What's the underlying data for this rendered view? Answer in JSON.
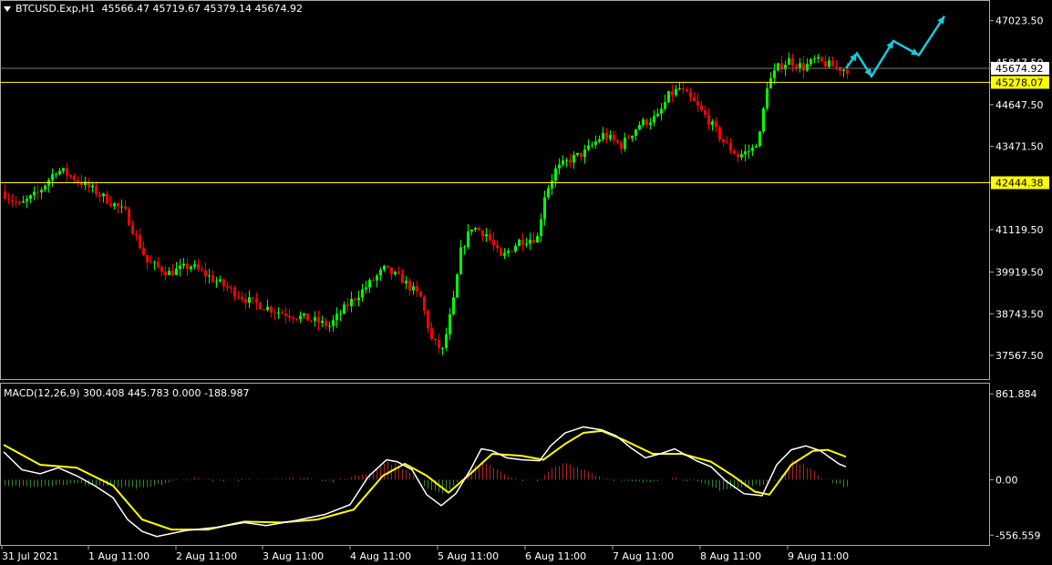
{
  "header": {
    "symbol": "BTCUSD.Exp,H1",
    "ohlc": "45566.47 45719.67 45379.14 45674.92"
  },
  "macd_header": {
    "text": "MACD(12,26,9) 300.408 445.783 0.000 -188.987"
  },
  "colors": {
    "background": "#000000",
    "bull": "#00ff00",
    "bear": "#ff0000",
    "level_line": "#ffff00",
    "forecast": "#1ec8dc",
    "macd_main": "#ffffff",
    "macd_signal": "#ffff00",
    "hist_pos": "#b22222",
    "hist_neg": "#2e8b2e"
  },
  "chart_data": [
    {
      "type": "candlestick",
      "timeframe": "H1",
      "ylim": [
        37000,
        47400
      ],
      "y_ticks": [
        "47023.50",
        "45847.50",
        "44647.50",
        "43471.50",
        "41119.50",
        "39919.50",
        "38743.50",
        "37567.50"
      ],
      "x_ticks": [
        "31 Jul 2021",
        "1 Aug 11:00",
        "2 Aug 11:00",
        "3 Aug 11:00",
        "4 Aug 11:00",
        "5 Aug 11:00",
        "6 Aug 11:00",
        "7 Aug 11:00",
        "8 Aug 11:00",
        "9 Aug 11:00"
      ],
      "price_path": [
        [
          0,
          42200
        ],
        [
          5,
          41800
        ],
        [
          10,
          42150
        ],
        [
          15,
          42800
        ],
        [
          17,
          42750
        ],
        [
          22,
          42450
        ],
        [
          30,
          41900
        ],
        [
          34,
          41600
        ],
        [
          40,
          40200
        ],
        [
          46,
          39900
        ],
        [
          52,
          40100
        ],
        [
          60,
          39600
        ],
        [
          68,
          39100
        ],
        [
          76,
          38800
        ],
        [
          84,
          38600
        ],
        [
          90,
          38400
        ],
        [
          95,
          39000
        ],
        [
          101,
          39600
        ],
        [
          105,
          40000
        ],
        [
          110,
          39700
        ],
        [
          115,
          39200
        ],
        [
          118,
          38000
        ],
        [
          121,
          37700
        ],
        [
          124,
          39100
        ],
        [
          126,
          40500
        ],
        [
          129,
          41200
        ],
        [
          133,
          41000
        ],
        [
          137,
          40300
        ],
        [
          142,
          40800
        ],
        [
          147,
          40900
        ],
        [
          149,
          42100
        ],
        [
          152,
          42800
        ],
        [
          156,
          43100
        ],
        [
          160,
          43300
        ],
        [
          165,
          43800
        ],
        [
          170,
          43500
        ],
        [
          175,
          44100
        ],
        [
          180,
          44300
        ],
        [
          183,
          44900
        ],
        [
          186,
          45100
        ],
        [
          190,
          44700
        ],
        [
          194,
          44200
        ],
        [
          198,
          43600
        ],
        [
          202,
          43200
        ],
        [
          206,
          43400
        ],
        [
          208,
          43800
        ],
        [
          210,
          45200
        ],
        [
          213,
          45700
        ],
        [
          216,
          45900
        ],
        [
          220,
          45700
        ],
        [
          223,
          45900
        ],
        [
          226,
          45800
        ],
        [
          229,
          45700
        ],
        [
          231,
          45650
        ]
      ],
      "current_price": "45674.92",
      "levels": [
        "45278.07",
        "42444.38"
      ],
      "forecast_path": [
        [
          231,
          45674
        ],
        [
          234,
          46100
        ],
        [
          238,
          45450
        ],
        [
          244,
          46450
        ],
        [
          251,
          46050
        ],
        [
          258,
          47150
        ]
      ]
    },
    {
      "type": "macd",
      "title": "MACD(12,26,9)",
      "ylim": [
        -600,
        900
      ],
      "y_ticks": [
        "861.884",
        "0.00",
        "-556.559"
      ],
      "macd_path": [
        [
          0,
          280
        ],
        [
          5,
          100
        ],
        [
          10,
          60
        ],
        [
          15,
          120
        ],
        [
          20,
          40
        ],
        [
          25,
          -60
        ],
        [
          30,
          -180
        ],
        [
          34,
          -400
        ],
        [
          38,
          -520
        ],
        [
          42,
          -570
        ],
        [
          50,
          -510
        ],
        [
          58,
          -480
        ],
        [
          66,
          -430
        ],
        [
          72,
          -460
        ],
        [
          80,
          -410
        ],
        [
          88,
          -350
        ],
        [
          95,
          -250
        ],
        [
          100,
          30
        ],
        [
          105,
          200
        ],
        [
          108,
          180
        ],
        [
          112,
          100
        ],
        [
          116,
          -150
        ],
        [
          120,
          -260
        ],
        [
          124,
          -140
        ],
        [
          128,
          100
        ],
        [
          131,
          310
        ],
        [
          134,
          290
        ],
        [
          138,
          220
        ],
        [
          142,
          200
        ],
        [
          147,
          190
        ],
        [
          150,
          340
        ],
        [
          154,
          470
        ],
        [
          159,
          530
        ],
        [
          164,
          500
        ],
        [
          168,
          440
        ],
        [
          172,
          320
        ],
        [
          176,
          220
        ],
        [
          180,
          260
        ],
        [
          184,
          310
        ],
        [
          190,
          190
        ],
        [
          194,
          130
        ],
        [
          198,
          -10
        ],
        [
          203,
          -140
        ],
        [
          208,
          -160
        ],
        [
          212,
          150
        ],
        [
          216,
          300
        ],
        [
          220,
          340
        ],
        [
          224,
          290
        ],
        [
          229,
          160
        ],
        [
          231,
          130
        ]
      ],
      "signal_path": [
        [
          0,
          350
        ],
        [
          10,
          150
        ],
        [
          20,
          120
        ],
        [
          30,
          -60
        ],
        [
          38,
          -400
        ],
        [
          46,
          -500
        ],
        [
          56,
          -500
        ],
        [
          66,
          -420
        ],
        [
          76,
          -430
        ],
        [
          86,
          -400
        ],
        [
          96,
          -300
        ],
        [
          104,
          40
        ],
        [
          110,
          160
        ],
        [
          116,
          40
        ],
        [
          122,
          -130
        ],
        [
          128,
          60
        ],
        [
          134,
          260
        ],
        [
          142,
          240
        ],
        [
          148,
          200
        ],
        [
          154,
          360
        ],
        [
          159,
          470
        ],
        [
          164,
          490
        ],
        [
          170,
          400
        ],
        [
          178,
          260
        ],
        [
          186,
          260
        ],
        [
          194,
          180
        ],
        [
          200,
          40
        ],
        [
          206,
          -120
        ],
        [
          210,
          -150
        ],
        [
          216,
          150
        ],
        [
          222,
          290
        ],
        [
          226,
          300
        ],
        [
          231,
          230
        ]
      ],
      "histogram_path": [
        [
          0,
          -70
        ],
        [
          10,
          -60
        ],
        [
          20,
          -40
        ],
        [
          30,
          -70
        ],
        [
          38,
          -90
        ],
        [
          46,
          -20
        ],
        [
          52,
          20
        ],
        [
          60,
          -20
        ],
        [
          66,
          10
        ],
        [
          74,
          10
        ],
        [
          84,
          20
        ],
        [
          90,
          -20
        ],
        [
          96,
          40
        ],
        [
          100,
          70
        ],
        [
          105,
          180
        ],
        [
          108,
          140
        ],
        [
          112,
          40
        ],
        [
          116,
          -80
        ],
        [
          120,
          -130
        ],
        [
          124,
          -40
        ],
        [
          128,
          110
        ],
        [
          131,
          160
        ],
        [
          134,
          130
        ],
        [
          138,
          40
        ],
        [
          142,
          -20
        ],
        [
          147,
          0
        ],
        [
          150,
          110
        ],
        [
          154,
          170
        ],
        [
          159,
          100
        ],
        [
          164,
          20
        ],
        [
          170,
          -20
        ],
        [
          176,
          -30
        ],
        [
          180,
          10
        ],
        [
          184,
          20
        ],
        [
          190,
          -30
        ],
        [
          196,
          -100
        ],
        [
          202,
          -80
        ],
        [
          208,
          -40
        ],
        [
          212,
          10
        ],
        [
          216,
          190
        ],
        [
          220,
          130
        ],
        [
          224,
          20
        ],
        [
          229,
          -50
        ],
        [
          231,
          -70
        ]
      ]
    }
  ]
}
